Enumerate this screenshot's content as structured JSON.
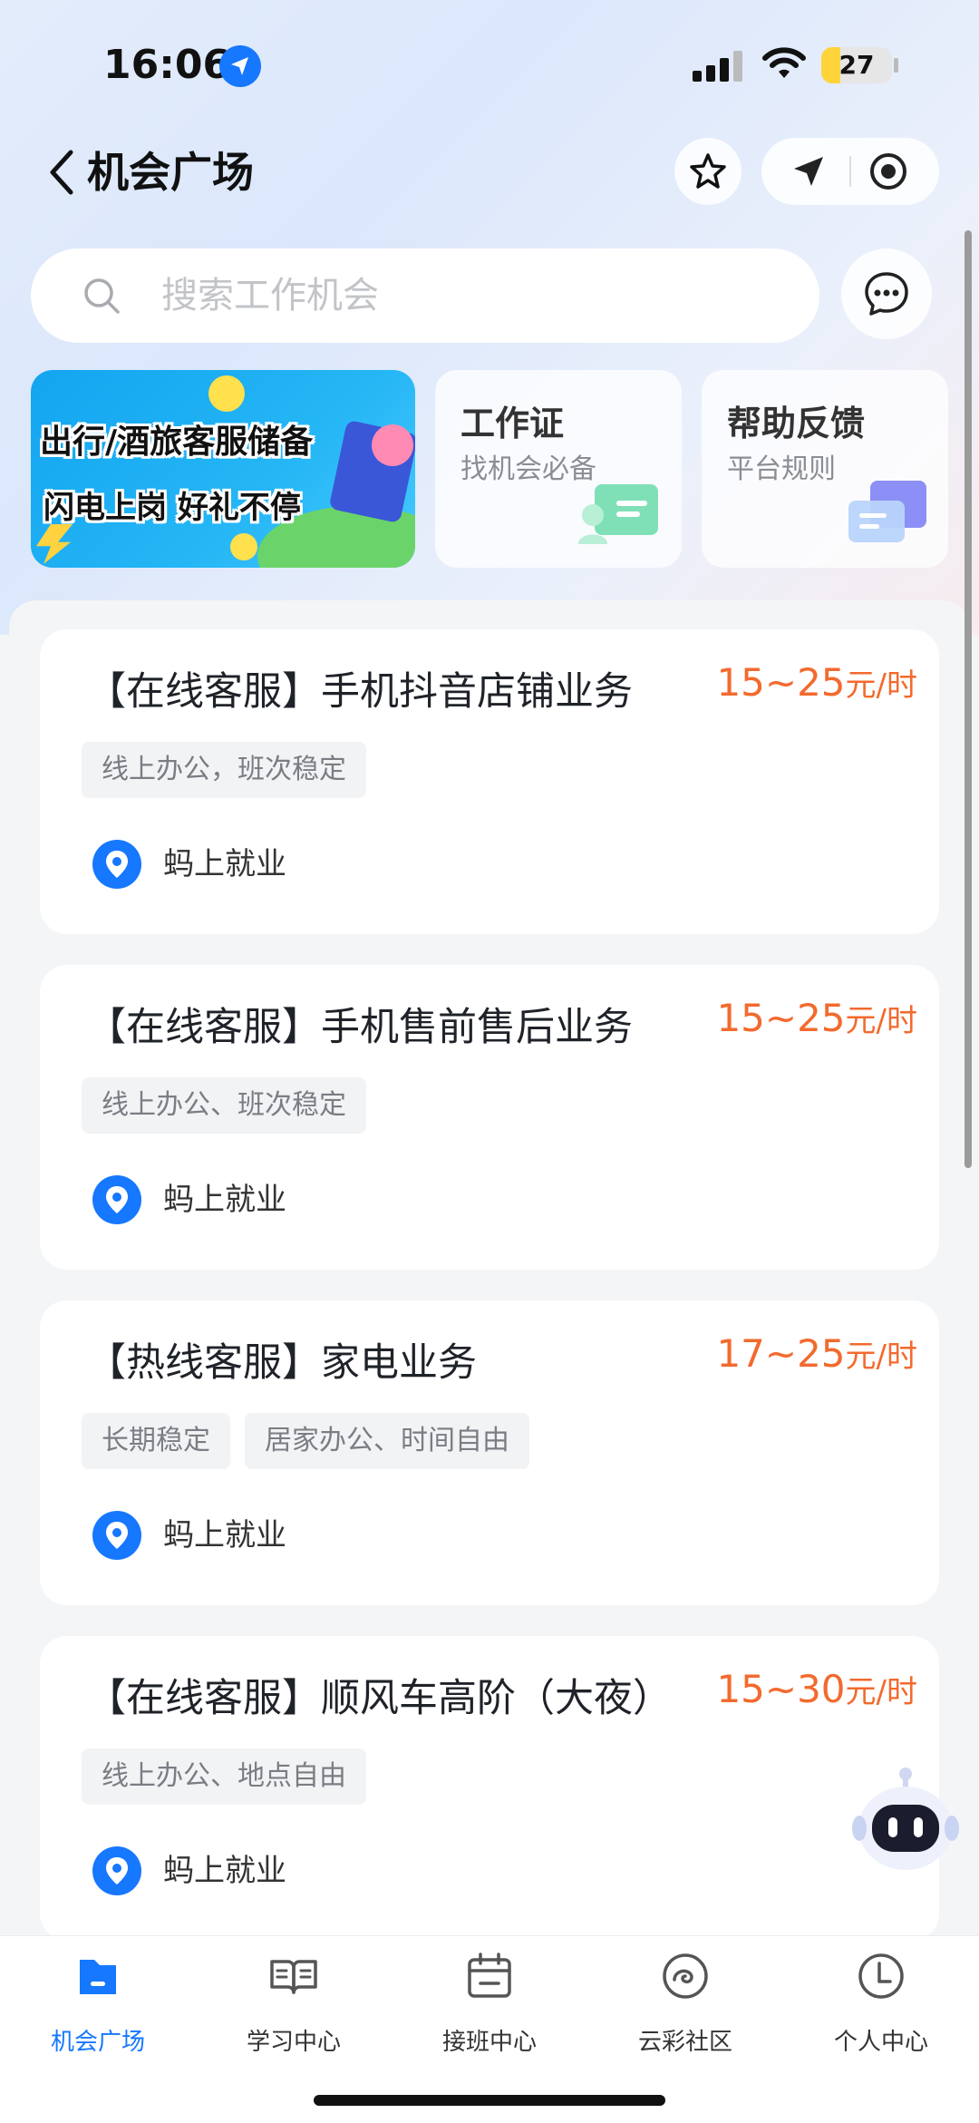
{
  "status_bar": {
    "time": "16:06",
    "battery": "27",
    "battery_level": 0.27
  },
  "header": {
    "title": "机会广场"
  },
  "search": {
    "placeholder": "搜索工作机会"
  },
  "banner": {
    "line1": "出行/酒旅客服储备",
    "line2": "闪电上岗 好礼不停"
  },
  "tiles": [
    {
      "title": "工作证",
      "subtitle": "找机会必备"
    },
    {
      "title": "帮助反馈",
      "subtitle": "平台规则"
    }
  ],
  "jobs": [
    {
      "title": "【在线客服】手机抖音店铺业务",
      "price": "15~25",
      "unit": "元/时",
      "tags": [
        "线上办公，班次稳定"
      ],
      "company": "蚂上就业"
    },
    {
      "title": "【在线客服】手机售前售后业务",
      "price": "15~25",
      "unit": "元/时",
      "tags": [
        "线上办公、班次稳定"
      ],
      "company": "蚂上就业"
    },
    {
      "title": "【热线客服】家电业务",
      "price": "17~25",
      "unit": "元/时",
      "tags": [
        "长期稳定",
        "居家办公、时间自由"
      ],
      "company": "蚂上就业"
    },
    {
      "title": "【在线客服】顺风车高阶（大夜）",
      "price": "15~30",
      "unit": "元/时",
      "tags": [
        "线上办公、地点自由"
      ],
      "company": "蚂上就业"
    }
  ],
  "tabbar": [
    {
      "label": "机会广场",
      "icon": "folder-icon",
      "active": true
    },
    {
      "label": "学习中心",
      "icon": "book-icon",
      "active": false
    },
    {
      "label": "接班中心",
      "icon": "calendar-icon",
      "active": false
    },
    {
      "label": "云彩社区",
      "icon": "cloud-icon",
      "active": false
    },
    {
      "label": "个人中心",
      "icon": "profile-icon",
      "active": false
    }
  ],
  "colors": {
    "accent": "#1677ff",
    "price": "#f26a2e",
    "tag_bg": "#f2f3f5"
  }
}
